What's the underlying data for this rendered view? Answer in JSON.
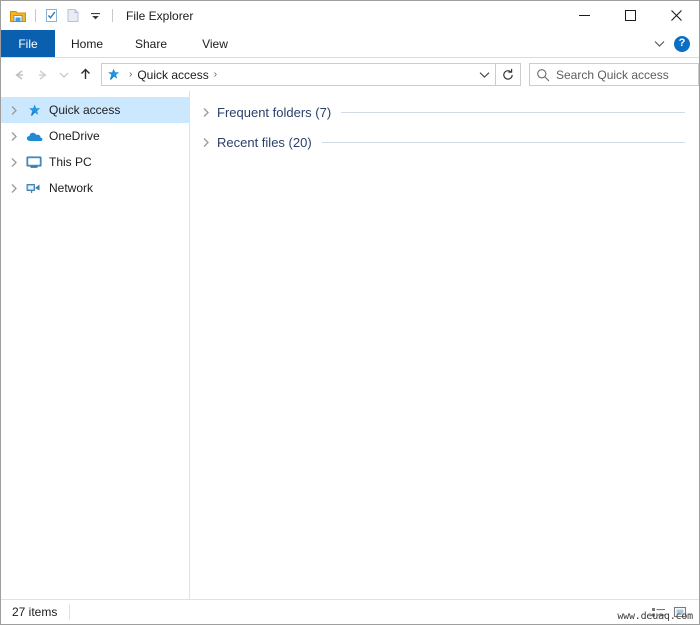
{
  "window": {
    "title": "File Explorer",
    "accent_blue": "#0a5faf",
    "selection_blue": "#cce8ff"
  },
  "quick_access_toolbar": {
    "items": [
      {
        "name": "folder-icon",
        "label": "File Explorer"
      },
      {
        "name": "properties-icon",
        "label": "Properties"
      },
      {
        "name": "new-folder-icon",
        "label": "New folder"
      },
      {
        "name": "customize-dropdown-icon",
        "label": "Customize Quick Access Toolbar"
      }
    ]
  },
  "window_controls": {
    "minimize": "—",
    "maximize": "☐",
    "close": "✕"
  },
  "ribbon": {
    "tabs": [
      {
        "label": "File",
        "selected": true
      },
      {
        "label": "Home",
        "selected": false
      },
      {
        "label": "Share",
        "selected": false
      },
      {
        "label": "View",
        "selected": false
      }
    ],
    "expand_icon": "chevron-down-icon",
    "help_label": "?"
  },
  "navigation": {
    "back_label": "Back",
    "forward_label": "Forward",
    "recent_label": "Recent locations",
    "up_label": "Up",
    "breadcrumb": {
      "icon": "pin-icon",
      "path": "Quick access",
      "separator": "›"
    },
    "address_dropdown": "chevron-down-icon",
    "refresh_label": "Refresh"
  },
  "search": {
    "placeholder": "Search Quick access",
    "icon": "search-icon"
  },
  "sidebar": {
    "items": [
      {
        "label": "Quick access",
        "icon": "pin-icon",
        "selected": true
      },
      {
        "label": "OneDrive",
        "icon": "cloud-icon",
        "selected": false
      },
      {
        "label": "This PC",
        "icon": "monitor-icon",
        "selected": false
      },
      {
        "label": "Network",
        "icon": "network-icon",
        "selected": false
      }
    ]
  },
  "main": {
    "groups": [
      {
        "label": "Frequent folders (7)",
        "expanded": false
      },
      {
        "label": "Recent files (20)",
        "expanded": false
      }
    ]
  },
  "statusbar": {
    "item_count": "27 items",
    "view_details_label": "Details view",
    "view_large_icons_label": "Large icons view"
  },
  "watermark": {
    "text": "www.deuaq.com"
  }
}
